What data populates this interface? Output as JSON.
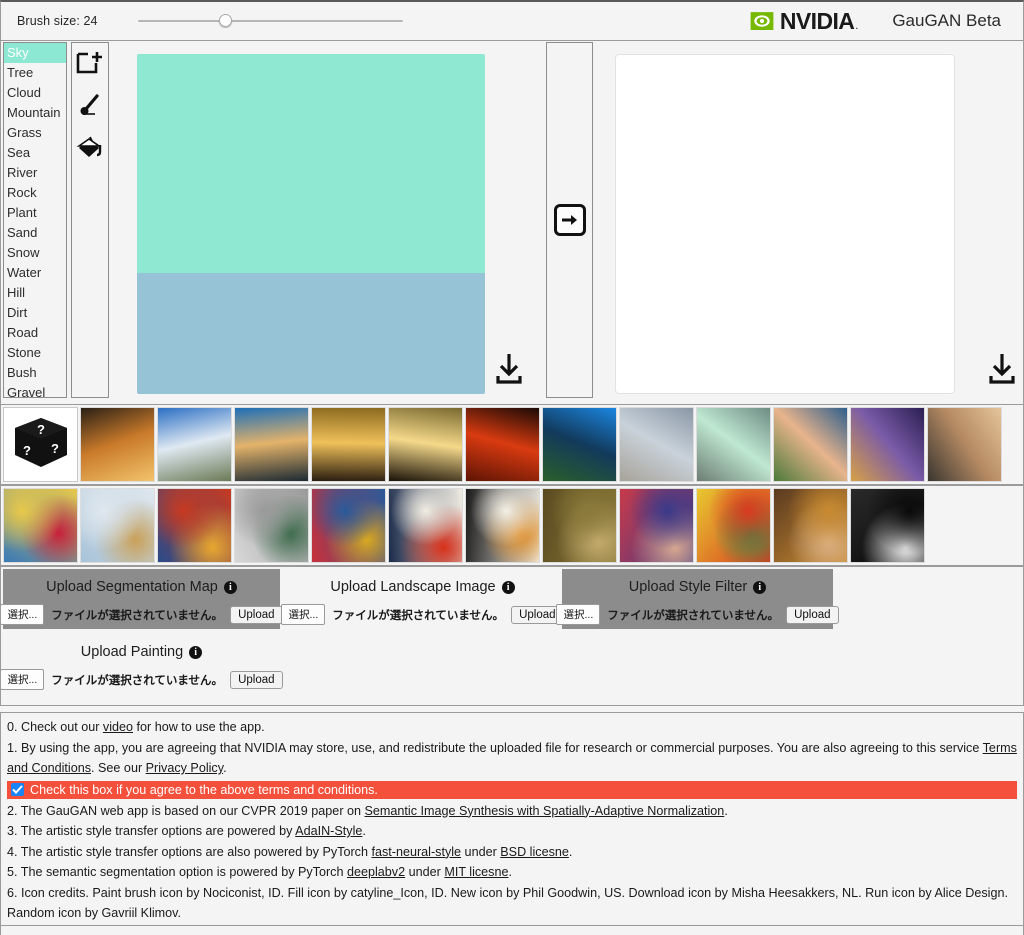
{
  "toolbar": {
    "brush_label": "Brush size: 24",
    "brush_value": 24,
    "slider_percent": 33,
    "brand_word": "NVIDIA",
    "brand_trademark": ".",
    "brand_icon": "nvidia-eye-logo",
    "brand_color": "#76b900",
    "app_title": "GauGAN Beta"
  },
  "labels": {
    "selected": "Sky",
    "selected_color": "#8ce8d2",
    "items": [
      {
        "label": "Sky"
      },
      {
        "label": "Tree"
      },
      {
        "label": "Cloud"
      },
      {
        "label": "Mountain"
      },
      {
        "label": "Grass"
      },
      {
        "label": "Sea"
      },
      {
        "label": "River"
      },
      {
        "label": "Rock"
      },
      {
        "label": "Plant"
      },
      {
        "label": "Sand"
      },
      {
        "label": "Snow"
      },
      {
        "label": "Water"
      },
      {
        "label": "Hill"
      },
      {
        "label": "Dirt"
      },
      {
        "label": "Road"
      },
      {
        "label": "Stone"
      },
      {
        "label": "Bush"
      },
      {
        "label": "Gravel"
      }
    ]
  },
  "tools": [
    {
      "name": "new-canvas-icon",
      "title": "New"
    },
    {
      "name": "paint-brush-icon",
      "title": "Paint brush"
    },
    {
      "name": "fill-bucket-icon",
      "title": "Fill"
    }
  ],
  "canvas": {
    "segments": [
      {
        "label": "Sky",
        "color": "#8ee8d2",
        "height_pct": 64.5
      },
      {
        "label": "Sea",
        "color": "#97c3d6",
        "height_pct": 35.5
      }
    ],
    "download_icon": "download-icon"
  },
  "run": {
    "icon": "arrow-right-run-icon",
    "title": "Run"
  },
  "output": {
    "empty": true,
    "background": "#ffffff",
    "download_icon": "download-icon"
  },
  "landscape_strip": {
    "random_icon": "random-dice-icon",
    "thumbs": [
      {
        "name": "sunset-trees-silhouette",
        "colors": [
          "#2a2016",
          "#c97a2a",
          "#f2c36a"
        ]
      },
      {
        "name": "highway-blue-sky-clouds",
        "colors": [
          "#2b6fc4",
          "#dfe9f2",
          "#6b7a55"
        ]
      },
      {
        "name": "coastal-dusk-teal",
        "colors": [
          "#1d6fb8",
          "#e4b36a",
          "#1c2a33"
        ]
      },
      {
        "name": "golden-sunset-water",
        "colors": [
          "#8c6a1f",
          "#f0c15a",
          "#2a1d10"
        ]
      },
      {
        "name": "beach-sunrise-reflection",
        "colors": [
          "#7a6a30",
          "#f5d98a",
          "#1a1208"
        ]
      },
      {
        "name": "deep-red-sun",
        "colors": [
          "#1a0a06",
          "#d93b10",
          "#5e1405"
        ]
      },
      {
        "name": "blue-fjord-cliff",
        "colors": [
          "#1b86e0",
          "#123a5c",
          "#2a5f2a"
        ]
      },
      {
        "name": "overcast-grey-shore",
        "colors": [
          "#8a97a6",
          "#c9d2da",
          "#a7a39a"
        ]
      },
      {
        "name": "green-flare-seascape",
        "colors": [
          "#6e8c84",
          "#bfe8d2",
          "#6c7d72"
        ]
      },
      {
        "name": "pink-cumulus-marsh",
        "colors": [
          "#2f5f8c",
          "#e8b48c",
          "#4c7a3a"
        ]
      },
      {
        "name": "purple-twilight-lagoon",
        "colors": [
          "#2b1f52",
          "#7a5ba8",
          "#d8a046"
        ]
      },
      {
        "name": "pale-orange-sunset-sea",
        "colors": [
          "#e5c49a",
          "#b58a63",
          "#3a3630"
        ]
      }
    ]
  },
  "style_strip": {
    "thumbs": [
      {
        "name": "abstract-circles-folk-art",
        "colors": [
          "#e8c84a",
          "#c8203a",
          "#3a7ab8"
        ]
      },
      {
        "name": "pastel-mandala-figure",
        "colors": [
          "#dfe7ee",
          "#c9a15a",
          "#a8c3d8"
        ]
      },
      {
        "name": "umbrella-girl-impasto",
        "colors": [
          "#c83a20",
          "#e8a830",
          "#2a4a8a"
        ]
      },
      {
        "name": "cubist-grey-figures",
        "colors": [
          "#9a9a9a",
          "#3a6a4a",
          "#d8d8d8"
        ]
      },
      {
        "name": "kandinsky-composition",
        "colors": [
          "#2a5a9a",
          "#d8a820",
          "#c8303a"
        ]
      },
      {
        "name": "red-hand-minimal",
        "colors": [
          "#f0ece2",
          "#d8301a",
          "#1a2a4a"
        ]
      },
      {
        "name": "pollock-action-painting",
        "colors": [
          "#f2efe6",
          "#e08a20",
          "#1a1a1a"
        ]
      },
      {
        "name": "golden-texture-circle",
        "colors": [
          "#8a7a3a",
          "#c8b070",
          "#5a4a20"
        ]
      },
      {
        "name": "blue-hat-portrait",
        "colors": [
          "#3a3a8a",
          "#d8a890",
          "#c83a4a"
        ]
      },
      {
        "name": "matisse-interior-nude",
        "colors": [
          "#d83a20",
          "#3a8a4a",
          "#e8c830"
        ]
      },
      {
        "name": "picasso-self-portrait",
        "colors": [
          "#c88a30",
          "#e0b890",
          "#5a3a20"
        ]
      },
      {
        "name": "black-white-streaks",
        "colors": [
          "#0a0a0a",
          "#f0f0f0",
          "#2a2a2a"
        ]
      }
    ]
  },
  "uploads": [
    {
      "name": "upload-segmentation-map",
      "title": "Upload Segmentation Map",
      "highlighted": true,
      "choose_label": "選択...",
      "file_status": "ファイルが選択されていません。",
      "upload_label": "Upload",
      "info_icon": "info-icon"
    },
    {
      "name": "upload-landscape-image",
      "title": "Upload Landscape Image",
      "highlighted": false,
      "choose_label": "選択...",
      "file_status": "ファイルが選択されていません。",
      "upload_label": "Upload",
      "info_icon": "info-icon"
    },
    {
      "name": "upload-style-filter",
      "title": "Upload Style Filter",
      "highlighted": true,
      "choose_label": "選択...",
      "file_status": "ファイルが選択されていません。",
      "upload_label": "Upload",
      "info_icon": "info-icon"
    },
    {
      "name": "upload-painting",
      "title": "Upload Painting",
      "highlighted": false,
      "choose_label": "選択...",
      "file_status": "ファイルが選択されていません。",
      "upload_label": "Upload",
      "info_icon": "info-icon"
    }
  ],
  "terms": {
    "line0_a": "0. Check out our ",
    "line0_link": "video",
    "line0_b": " for how to use the app.",
    "line1_a": "1. By using the app, you are agreeing that NVIDIA may store, use, and redistribute the uploaded file for research or commercial purposes. You are also agreeing to this service ",
    "line1_link1": "Terms and Conditions",
    "line1_b": ". See our ",
    "line1_link2": "Privacy Policy",
    "line1_c": ".",
    "agree_text": "Check this box if you agree to the above terms and conditions.",
    "agree_checked": true,
    "agree_bar_color": "#f4503c",
    "agree_checkbox_color": "#1a84f7",
    "line2_a": "2. The GauGAN web app is based on our CVPR 2019 paper on ",
    "line2_link": "Semantic Image Synthesis with Spatially-Adaptive Normalization",
    "line2_b": ".",
    "line3_a": "3. The artistic style transfer options are powered by ",
    "line3_link": "AdaIN-Style",
    "line3_b": ".",
    "line4_a": "4. The artistic style transfer options are also powered by PyTorch ",
    "line4_link1": "fast-neural-style",
    "line4_b": " under ",
    "line4_link2": "BSD licesne",
    "line4_c": ".",
    "line5_a": "5. The semantic segmentation option is powered by PyTorch ",
    "line5_link1": "deeplabv2",
    "line5_b": " under ",
    "line5_link2": "MIT licesne",
    "line5_c": ".",
    "line6": "6. Icon credits. Paint brush icon by Nociconist, ID. Fill icon by catyline_Icon, ID. New icon by Phil Goodwin, US. Download icon by Misha Heesakkers, NL. Run icon by Alice Design. Random icon by Gavriil Klimov."
  }
}
